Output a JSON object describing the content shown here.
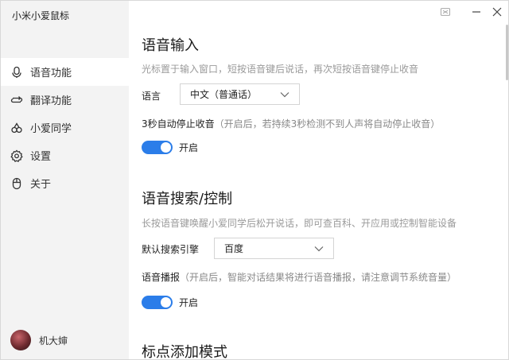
{
  "app": {
    "title": "小米小爱鼠标"
  },
  "sidebar": {
    "items": [
      {
        "label": "语音功能",
        "icon": "microphone-icon",
        "active": true
      },
      {
        "label": "翻译功能",
        "icon": "translate-icon",
        "active": false
      },
      {
        "label": "小爱同学",
        "icon": "xiaoai-icon",
        "active": false
      },
      {
        "label": "设置",
        "icon": "gear-icon",
        "active": false
      },
      {
        "label": "关于",
        "icon": "mouse-icon",
        "active": false
      }
    ],
    "user": {
      "name": "机大婶"
    }
  },
  "voice_input": {
    "title": "语音输入",
    "description": "光标置于输入窗口，短按语音键后说话，再次短按语音键停止收音",
    "language_label": "语言",
    "language_value": "中文（普通话）",
    "auto_stop_label": "3秒自动停止收音",
    "auto_stop_hint": "（开启后，若持续3秒检测不到人声将自动停止收音）",
    "auto_stop_toggle_label": "开启",
    "auto_stop_on": true
  },
  "voice_search": {
    "title": "语音搜索/控制",
    "description": "长按语音键唤醒小爱同学后松开说话，即可查百科、开应用或控制智能设备",
    "engine_label": "默认搜索引擎",
    "engine_value": "百度",
    "broadcast_label": "语音播报",
    "broadcast_hint": "（开启后，智能对话结果将进行语音播报，请注意调节系统音量）",
    "broadcast_toggle_label": "开启",
    "broadcast_on": true
  },
  "punctuation": {
    "title": "标点添加模式"
  },
  "colors": {
    "accent": "#2b7de9",
    "sidebar_bg": "#f3f3f3"
  }
}
